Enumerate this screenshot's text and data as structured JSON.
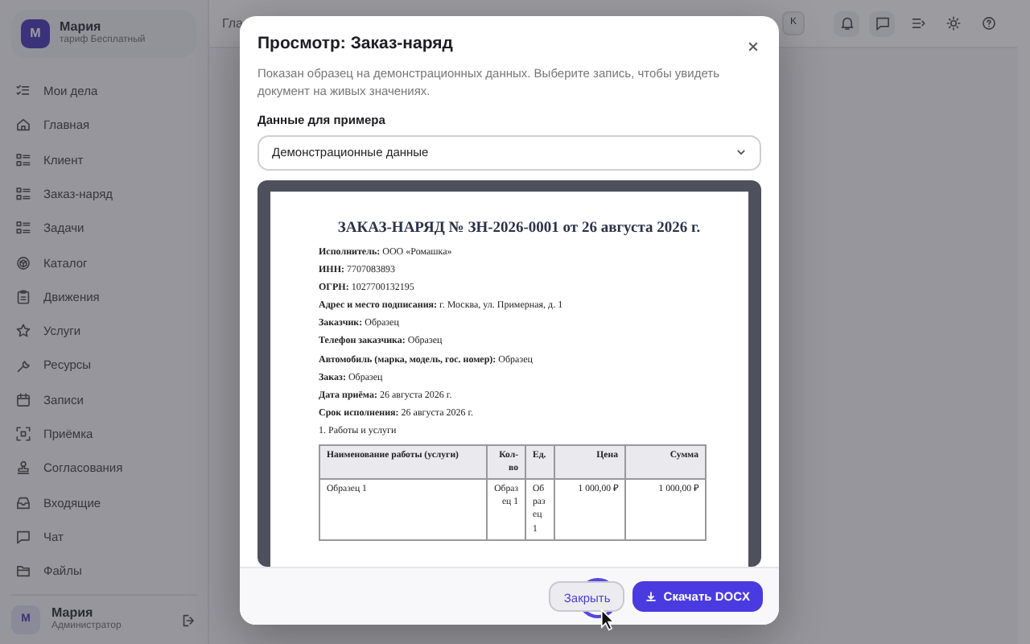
{
  "sidebar": {
    "profile": {
      "avatar": "М",
      "name": "Мария",
      "plan": "тариф Бесплатный"
    },
    "items": [
      {
        "label": "Мои дела"
      },
      {
        "label": "Главная"
      },
      {
        "label": "Клиент"
      },
      {
        "label": "Заказ-наряд"
      },
      {
        "label": "Задачи"
      },
      {
        "label": "Каталог"
      },
      {
        "label": "Движения"
      },
      {
        "label": "Услуги"
      },
      {
        "label": "Ресурсы"
      },
      {
        "label": "Записи"
      },
      {
        "label": "Приёмка"
      },
      {
        "label": "Согласования"
      },
      {
        "label": "Входящие"
      },
      {
        "label": "Чат"
      },
      {
        "label": "Файлы"
      }
    ],
    "user": {
      "avatar": "М",
      "name": "Мария",
      "role": "Администратор"
    }
  },
  "topbar": {
    "title": "Гла",
    "shortcut": "K"
  },
  "modal": {
    "title": "Просмотр: Заказ-наряд",
    "description": "Показан образец на демонстрационных данных. Выберите запись, чтобы увидеть документ на живых значениях.",
    "field_label": "Данные для примера",
    "select_value": "Демонстрационные данные",
    "document": {
      "heading": "ЗАКАЗ-НАРЯД № ЗН-2026-0001 от 26 августа 2026 г.",
      "fields": [
        "**Исполнитель:** ООО «Ромашка»",
        "**ИНН:** 7707083893",
        "**ОГРН:** 1027700132195",
        "**Адрес и место подписания:** г. Москва, ул. Примерная, д. 1",
        "**Заказчик:** Образец",
        "**Телефон заказчика:** Образец",
        "**Автомобиль (марка, модель, гос. номер):** Образец",
        "**Заказ:** Образец",
        "**Дата приёма:** 26 августа 2026 г.",
        "**Срок исполнения:** 26 августа 2026 г."
      ],
      "section": "1. Работы и услуги",
      "table": {
        "columns": [
          "Наименование работы (услуги)",
          "Кол-во",
          "Ед.",
          "Цена",
          "Сумма"
        ],
        "rows": [
          [
            "Образец 1",
            "Образец 1",
            "Образец 1",
            "1 000,00 ₽",
            "1 000,00 ₽"
          ]
        ]
      }
    },
    "buttons": [
      {
        "label": "Закрыть",
        "kind": "secondary"
      },
      {
        "label": "Скачать DOCX",
        "kind": "primary"
      }
    ]
  }
}
